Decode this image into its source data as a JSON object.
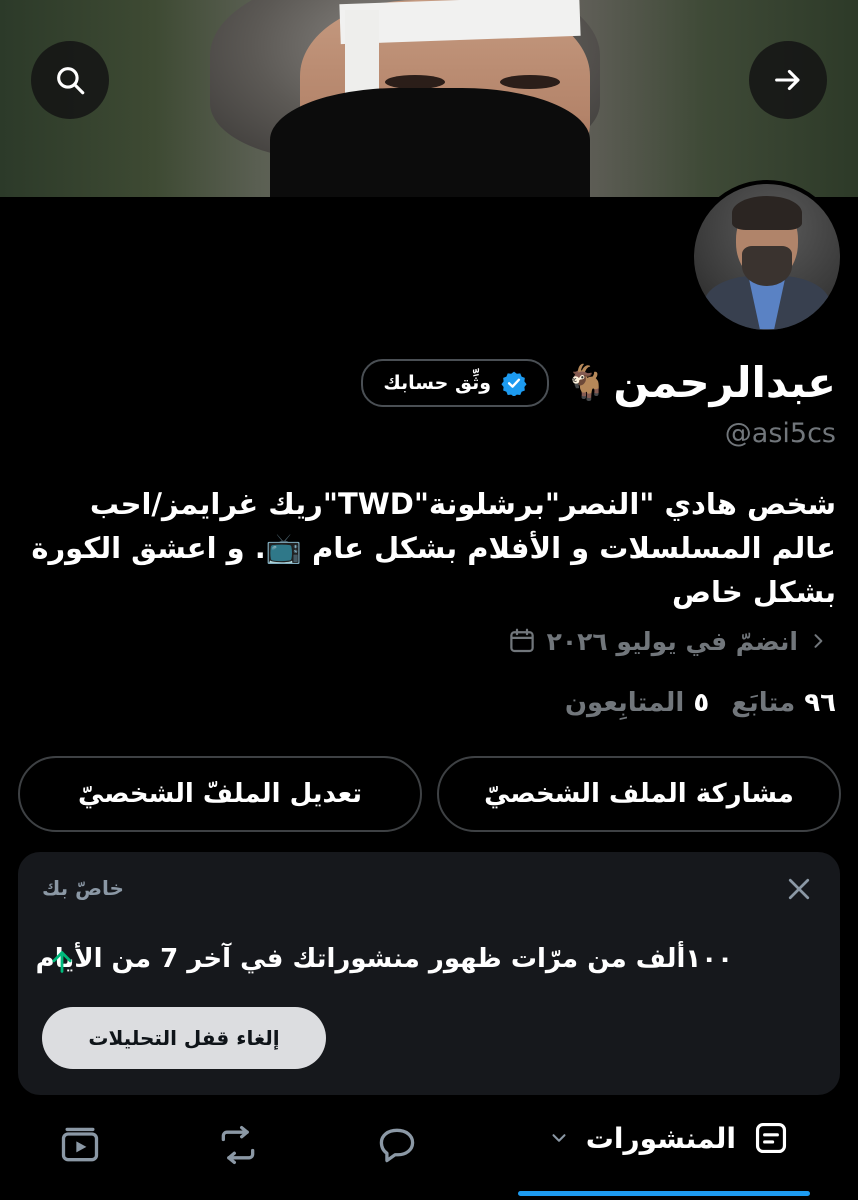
{
  "header": {
    "search_icon": "search-icon",
    "forward_icon": "arrow-right-icon"
  },
  "profile": {
    "display_name": "عبدالرحمن",
    "name_emoji": "🐐",
    "verify_label": "وثِّق حسابك",
    "handle": "@asi5cs",
    "bio": "شخص هادي \"النصر\"برشلونة\"TWD\"ريك غرايمز/احب عالم المسلسلات و الأفلام بشكل عام 📺. و اعشق الكورة بشكل خاص",
    "joined": "انضمّ في يوليو ٢٠٢٦",
    "following_count": "٩٦",
    "following_label": "متابَع",
    "followers_count": "٥",
    "followers_label": "المتابِعون"
  },
  "actions": {
    "share_label": "مشاركة الملف الشخصيّ",
    "edit_label": "تعديل الملفّ الشخصيّ"
  },
  "card": {
    "title": "خاصّ بك",
    "stat_text": "١٠٠ألف من مرّات ظهور منشوراتك في آخر 7 من الأيام",
    "button_label": "إلغاء قفل التحليلات"
  },
  "tabs": {
    "active_label": "المنشورات"
  },
  "colors": {
    "accent": "#1d9bf0",
    "verified": "#1d9bf0",
    "trend_up": "#00ba7c"
  }
}
